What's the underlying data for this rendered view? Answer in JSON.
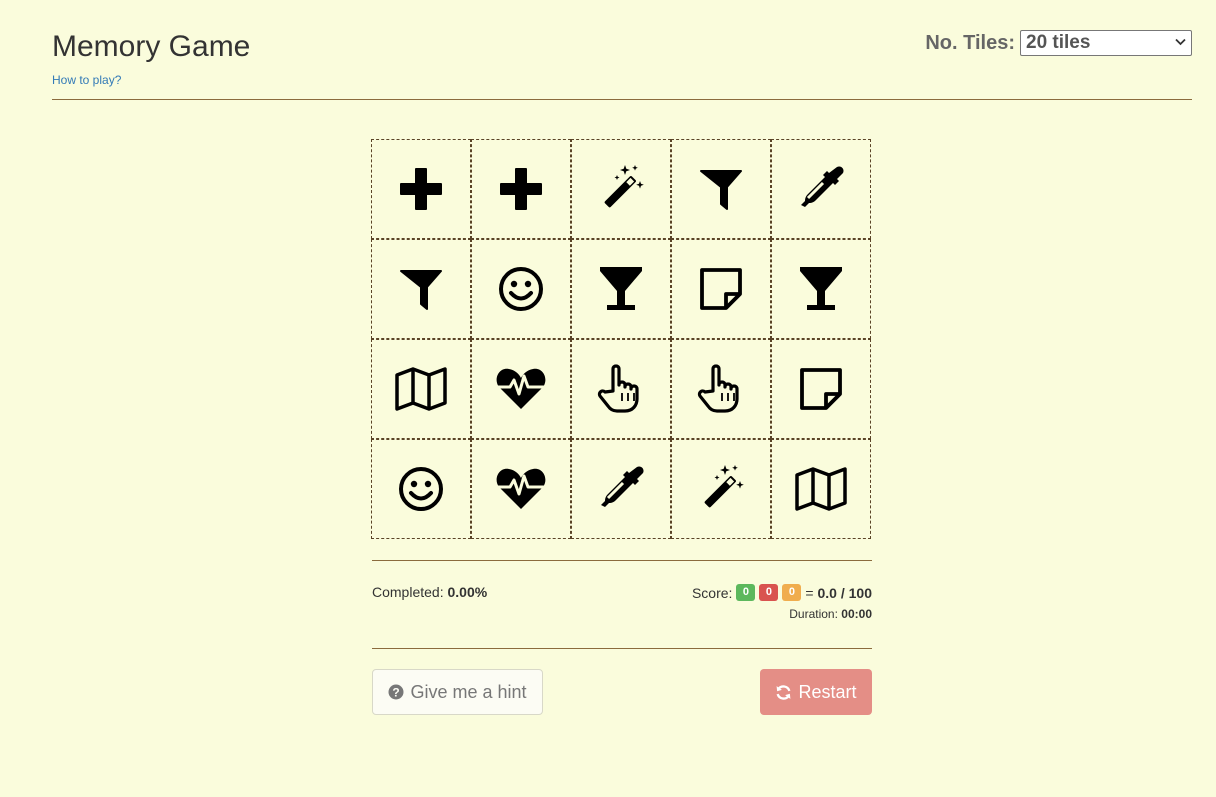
{
  "header": {
    "title": "Memory Game",
    "how_to_play": "How to play?",
    "tiles_label": "No. Tiles:",
    "tiles_value": "20 tiles"
  },
  "board": {
    "tiles": [
      "plus-icon",
      "plus-icon",
      "magic-wand-icon",
      "filter-icon",
      "eyedropper-icon",
      "filter-icon",
      "smiley-icon",
      "cocktail-glass-icon",
      "sticky-note-icon",
      "cocktail-glass-icon",
      "map-icon",
      "heartbeat-icon",
      "pointing-hand-icon",
      "pointing-hand-icon",
      "sticky-note-icon",
      "smiley-icon",
      "heartbeat-icon",
      "eyedropper-icon",
      "magic-wand-icon",
      "map-icon"
    ]
  },
  "stats": {
    "completed_label": "Completed:",
    "completed_value": "0.00%",
    "score_label": "Score:",
    "score_correct": "0",
    "score_wrong": "0",
    "score_hints": "0",
    "score_total": "= ",
    "score_value": "0.0 / 100",
    "duration_label": "Duration:",
    "duration_value": "00:00",
    "colors": {
      "correct": "#5cb85c",
      "wrong": "#d9534f",
      "hints": "#f0ad4e"
    }
  },
  "actions": {
    "hint_label": "Give me a hint",
    "restart_label": "Restart"
  }
}
